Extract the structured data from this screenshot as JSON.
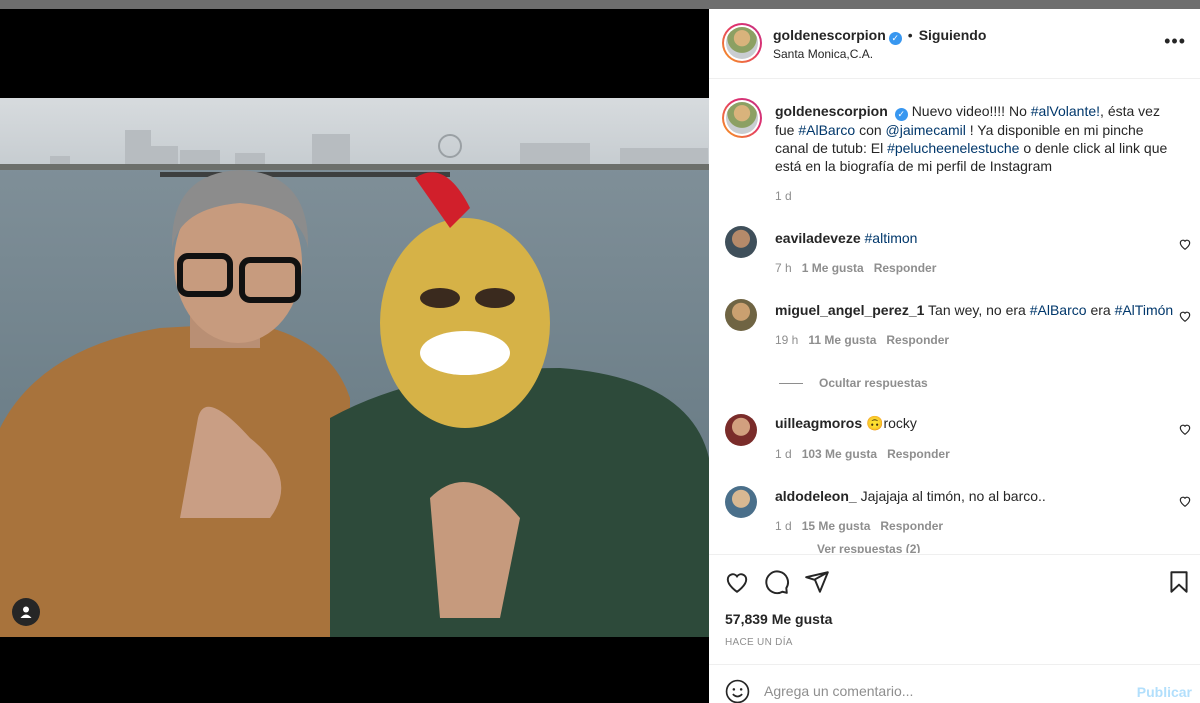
{
  "post": {
    "username": "goldenescorpion",
    "follow_label": "Siguiendo",
    "separator": "•",
    "location": "Santa Monica,C.A.",
    "more_label": "•••",
    "caption": {
      "t1": "Nuevo video!!!! No",
      "tag1": "#alVolante!",
      "t2": ", ésta vez fue",
      "tag2": "#AlBarco",
      "t3": "con",
      "tag3": "@jaimecamil",
      "t4": "! Ya disponible en mi pinche canal de tutub: El",
      "tag4": "#pelucheenelestuche",
      "t5": "o denle click al link que está en la biografía de mi perfil de Instagram",
      "time": "1 d"
    },
    "likes": "57,839 Me gusta",
    "posted_ago": "HACE UN DÍA"
  },
  "comments": [
    {
      "user": "eaviladeveze",
      "text": "",
      "tag": "#altimon",
      "time": "7 h",
      "likes": "1 Me gusta",
      "reply": "Responder"
    },
    {
      "user": "miguel_angel_perez_1",
      "text": "Tan wey, no era",
      "tag": "#AlBarco",
      "text2": "era",
      "tag2": "#AlTimón",
      "time": "19 h",
      "likes": "11 Me gusta",
      "reply": "Responder"
    },
    {
      "user": "uilleagmoros",
      "emoji": "🙃",
      "text": "rocky",
      "time": "1 d",
      "likes": "103 Me gusta",
      "reply": "Responder"
    },
    {
      "user": "aldodeleon_",
      "text": "Jajajaja al timón, no al barco..",
      "time": "1 d",
      "likes": "15 Me gusta",
      "reply": "Responder"
    }
  ],
  "hide_replies": "Ocultar respuestas",
  "view_replies": "Ver respuestas (2)",
  "add_comment": {
    "placeholder": "Agrega un comentario...",
    "publish": "Publicar"
  },
  "icons": [
    "tag-user-icon",
    "heart-icon",
    "comment-icon",
    "share-icon",
    "bookmark-icon",
    "emoji-icon",
    "more-options-icon",
    "verified-badge-icon"
  ],
  "colors": {
    "accent_link": "#00376b",
    "verified": "#3897f0",
    "muted": "#8e8e8e",
    "publish_disabled": "#b2dffc"
  }
}
